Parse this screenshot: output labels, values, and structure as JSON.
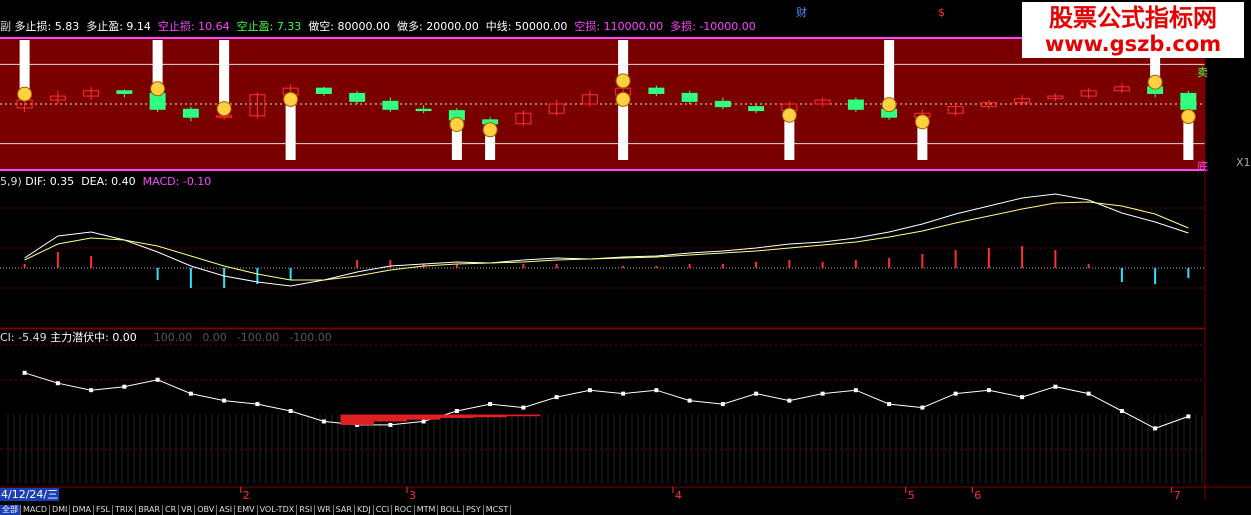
{
  "top_markers": {
    "cai": "财",
    "dollar": "$"
  },
  "watermark": {
    "line1": "股票公式指标网",
    "line2": "www.gszb.com"
  },
  "panel1": {
    "title_prefix": "副",
    "items": [
      {
        "label": "多止损:",
        "value": "5.83",
        "color": "#ffffff"
      },
      {
        "label": "多止盈:",
        "value": "9.14",
        "color": "#ffffff"
      },
      {
        "label": "空止损:",
        "value": "10.64",
        "color": "#ff44ff"
      },
      {
        "label": "空止盈:",
        "value": "7.33",
        "color": "#44ff44"
      },
      {
        "label": "做空:",
        "value": "80000.00",
        "color": "#ffffff"
      },
      {
        "label": "做多:",
        "value": "20000.00",
        "color": "#ffffff"
      },
      {
        "label": "中线:",
        "value": "50000.00",
        "color": "#ffffff"
      },
      {
        "label": "空损:",
        "value": "110000.00",
        "color": "#ff44ff"
      },
      {
        "label": "多损:",
        "value": "-10000.00",
        "color": "#ff44ff"
      }
    ],
    "sell_label": "卖",
    "bottom_label": "底",
    "right_label": "X1"
  },
  "panel2": {
    "title_prefix": "5,9)",
    "items": [
      {
        "label": "DIF:",
        "value": "0.35",
        "color": "#ffffff"
      },
      {
        "label": "DEA:",
        "value": "0.40",
        "color": "#ffffff"
      },
      {
        "label": "MACD:",
        "value": "-0.10",
        "color": "#ff44ff"
      }
    ]
  },
  "panel3": {
    "title_prefix": "CI:",
    "cci_value": "-5.49",
    "items": [
      {
        "label": "主力潜伏中:",
        "value": "0.00",
        "color": "#ffffff"
      }
    ],
    "refs": [
      "100.00",
      "0.00",
      "-100.00",
      "-100.00"
    ]
  },
  "time_axis": {
    "date_label": "4/12/24/三",
    "months": [
      {
        "label": "2",
        "index": 7
      },
      {
        "label": "3",
        "index": 12
      },
      {
        "label": "4",
        "index": 20
      },
      {
        "label": "5",
        "index": 27
      },
      {
        "label": "6",
        "index": 29
      },
      {
        "label": "7",
        "index": 35
      }
    ]
  },
  "tabs": [
    "全部",
    "MACD",
    "DMI",
    "DMA",
    "FSL",
    "TRIX",
    "BRAR",
    "CR",
    "VR",
    "OBV",
    "ASI",
    "EMV",
    "VOL-TDX",
    "RSI",
    "WR",
    "SAR",
    "KDJ",
    "CCI",
    "ROC",
    "MTM",
    "BOLL",
    "PSY",
    "MCST"
  ],
  "colors": {
    "panel_bg": "#7a0000",
    "up": "#ff3030",
    "down": "#30ff80",
    "band": "#ff44ff",
    "grid": "#7a0000"
  },
  "chart_data": [
    {
      "type": "candlestick",
      "title": "",
      "levels": {
        "upper": 80000,
        "middle": 50000,
        "lower": 20000
      },
      "x": [
        1,
        2,
        3,
        4,
        5,
        6,
        7,
        8,
        9,
        10,
        11,
        12,
        13,
        14,
        15,
        16,
        17,
        18,
        19,
        20,
        21,
        22,
        23,
        24,
        25,
        26,
        27,
        28,
        29,
        30,
        31,
        32,
        33,
        34,
        35,
        36
      ],
      "open": [
        47,
        53,
        56,
        60,
        58,
        46,
        40,
        41,
        57,
        62,
        58,
        52,
        46,
        45,
        38,
        35,
        43,
        50,
        57,
        62,
        58,
        52,
        48,
        45,
        50,
        53,
        46,
        40,
        43,
        48,
        51,
        54,
        56,
        60,
        63,
        58
      ],
      "close": [
        53,
        56,
        60,
        58,
        46,
        40,
        41,
        57,
        62,
        58,
        52,
        46,
        45,
        38,
        35,
        43,
        50,
        57,
        62,
        58,
        52,
        48,
        45,
        50,
        53,
        46,
        40,
        43,
        48,
        51,
        54,
        56,
        60,
        63,
        58,
        46
      ],
      "high": [
        56,
        60,
        63,
        61,
        60,
        48,
        45,
        59,
        65,
        63,
        60,
        55,
        49,
        47,
        40,
        45,
        53,
        60,
        66,
        64,
        60,
        55,
        50,
        52,
        55,
        55,
        48,
        46,
        50,
        53,
        57,
        58,
        62,
        66,
        65,
        60
      ],
      "low": [
        44,
        50,
        53,
        55,
        44,
        37,
        38,
        39,
        55,
        56,
        50,
        44,
        43,
        36,
        32,
        33,
        41,
        48,
        55,
        56,
        50,
        46,
        43,
        43,
        48,
        44,
        38,
        38,
        41,
        46,
        49,
        52,
        54,
        58,
        55,
        42
      ],
      "top_signals": [
        1,
        5,
        7,
        19,
        27,
        35
      ],
      "bottom_signals": [
        9,
        14,
        15,
        19,
        24,
        28,
        36
      ]
    },
    {
      "type": "line",
      "title": "",
      "series": [
        {
          "name": "DIF",
          "color": "#ffffff",
          "values": [
            0.1,
            0.32,
            0.36,
            0.28,
            0.16,
            0.02,
            -0.08,
            -0.14,
            -0.18,
            -0.12,
            -0.04,
            0.02,
            0.04,
            0.06,
            0.05,
            0.08,
            0.1,
            0.09,
            0.11,
            0.12,
            0.15,
            0.17,
            0.2,
            0.24,
            0.26,
            0.3,
            0.36,
            0.44,
            0.54,
            0.62,
            0.7,
            0.74,
            0.68,
            0.55,
            0.46,
            0.35
          ]
        },
        {
          "name": "DEA",
          "color": "#ffff88",
          "values": [
            0.08,
            0.24,
            0.3,
            0.28,
            0.22,
            0.12,
            0.02,
            -0.06,
            -0.12,
            -0.12,
            -0.08,
            -0.02,
            0.02,
            0.04,
            0.05,
            0.06,
            0.08,
            0.09,
            0.1,
            0.11,
            0.13,
            0.15,
            0.17,
            0.2,
            0.23,
            0.26,
            0.31,
            0.37,
            0.45,
            0.52,
            0.59,
            0.65,
            0.66,
            0.62,
            0.54,
            0.4
          ]
        },
        {
          "name": "MACD",
          "color": "#ff44ff",
          "values": [
            0.04,
            0.16,
            0.12,
            0.0,
            -0.12,
            -0.2,
            -0.2,
            -0.16,
            -0.12,
            0.0,
            0.08,
            0.08,
            0.04,
            0.04,
            0.0,
            0.04,
            0.04,
            0.0,
            0.02,
            0.02,
            0.04,
            0.04,
            0.06,
            0.08,
            0.06,
            0.08,
            0.1,
            0.14,
            0.18,
            0.2,
            0.22,
            0.18,
            0.04,
            -0.14,
            -0.16,
            -0.1
          ]
        }
      ],
      "ylim": [
        -0.6,
        0.8
      ]
    },
    {
      "type": "line",
      "title": "",
      "series": [
        {
          "name": "CCI",
          "color": "#ffffff",
          "values": [
            120,
            90,
            70,
            80,
            100,
            60,
            40,
            30,
            10,
            -20,
            -30,
            -30,
            -20,
            10,
            30,
            20,
            50,
            70,
            60,
            70,
            40,
            30,
            60,
            40,
            60,
            70,
            30,
            20,
            60,
            70,
            50,
            80,
            60,
            10,
            -40,
            -5.49
          ]
        },
        {
          "name": "主力潜伏中",
          "color": "#e02020",
          "values": [
            0,
            0,
            0,
            0,
            0,
            0,
            0,
            0,
            0,
            0,
            -30,
            -20,
            -15,
            -10,
            -8,
            -5,
            0,
            0,
            0,
            0,
            0,
            0,
            0,
            0,
            0,
            0,
            0,
            0,
            0,
            0,
            0,
            0,
            0,
            0,
            0,
            0
          ]
        }
      ],
      "ylim": [
        -200,
        200
      ]
    }
  ]
}
